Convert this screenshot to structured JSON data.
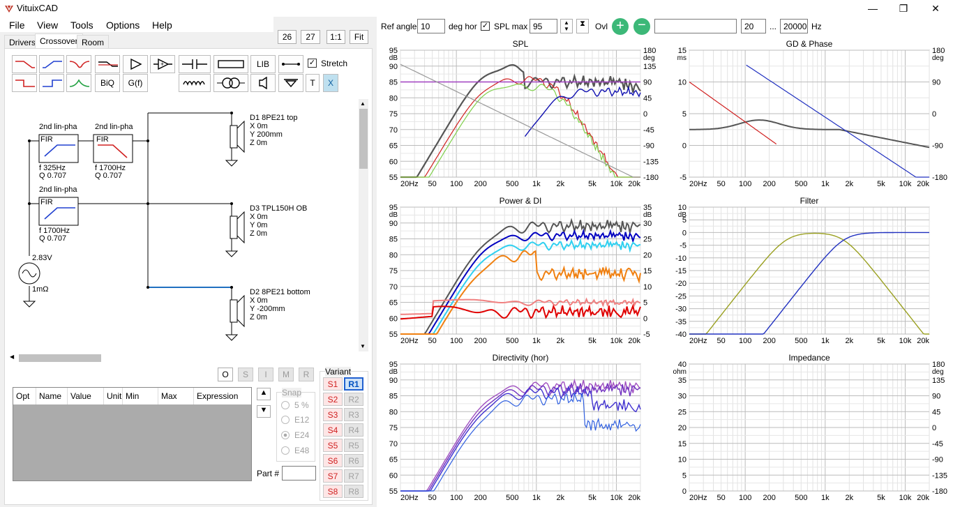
{
  "app": {
    "title": "VituixCAD"
  },
  "window": {
    "minimize": "—",
    "restore": "❐",
    "close": "✕"
  },
  "menu": [
    "File",
    "View",
    "Tools",
    "Options",
    "Help"
  ],
  "zoom": {
    "v1": "26",
    "v2": "27",
    "btn1": "1:1",
    "btn2": "Fit"
  },
  "tabs": [
    "Drivers",
    "Crossover",
    "Room"
  ],
  "toolbar": {
    "lib": "LIB",
    "biq": "BiQ",
    "gf": "G(f)",
    "t": "T",
    "x": "X",
    "stretch": "Stretch"
  },
  "schematic": {
    "blocks": [
      {
        "title": "2nd lin-pha",
        "type": "FIR",
        "f": "f   325Hz",
        "q": "Q  0.707"
      },
      {
        "title": "2nd lin-pha",
        "type": "FIR",
        "f": "f   1700Hz",
        "q": "Q  0.707"
      },
      {
        "title": "2nd lin-pha",
        "type": "FIR",
        "f": "f   1700Hz",
        "q": "Q  0.707"
      }
    ],
    "drivers": [
      {
        "name": "D1 8PE21 top",
        "x": "X 0m",
        "y": "Y 200mm",
        "z": "Z 0m"
      },
      {
        "name": "D3 TPL150H OB",
        "x": "X 0m",
        "y": "Y 0m",
        "z": "Z 0m"
      },
      {
        "name": "D2 8PE21 bottom",
        "x": "X 0m",
        "y": "Y -200mm",
        "z": "Z 0m"
      }
    ],
    "source_voltage": "2.83V",
    "source_r": "1mΩ"
  },
  "optbuttons": [
    "O",
    "S",
    "I",
    "M",
    "R"
  ],
  "table_headers": [
    "Opt",
    "Name",
    "Value",
    "Unit",
    "Min",
    "Max",
    "Expression"
  ],
  "snap": {
    "label": "Snap",
    "options": [
      "5 %",
      "E12",
      "E24",
      "E48"
    ],
    "selected": "E24"
  },
  "part": {
    "label": "Part #",
    "value": ""
  },
  "variant": {
    "label": "Variant",
    "s": [
      "S1",
      "S2",
      "S3",
      "S4",
      "S5",
      "S6",
      "S7",
      "S8"
    ],
    "r": [
      "R1",
      "R2",
      "R3",
      "R4",
      "R5",
      "R6",
      "R7",
      "R8"
    ]
  },
  "controls": {
    "ref_angle_label": "Ref angle",
    "ref_angle": "10",
    "deg_hor": "deg hor",
    "spl_max_label": "SPL max",
    "spl_max": "95",
    "ovl": "Ovl",
    "freq_from": "20",
    "dots": "...",
    "freq_to": "20000",
    "hz": "Hz"
  },
  "charts": {
    "xticks": [
      "20Hz",
      "50",
      "100",
      "200",
      "500",
      "1k",
      "2k",
      "5k",
      "10k",
      "20k"
    ],
    "spl": {
      "title": "SPL",
      "yl": [
        "95",
        "90",
        "85",
        "80",
        "75",
        "70",
        "65",
        "60",
        "55"
      ],
      "yr": [
        "180",
        "135",
        "90",
        "45",
        "0",
        "-45",
        "-90",
        "-135",
        "-180"
      ],
      "ul": "dB",
      "ur": "deg"
    },
    "gd": {
      "title": "GD & Phase",
      "yl": [
        "15",
        "10",
        "5",
        "0",
        "-5"
      ],
      "yr": [
        "180",
        "90",
        "0",
        "-90",
        "-180"
      ],
      "ul": "ms",
      "ur": "deg"
    },
    "power": {
      "title": "Power & DI",
      "yl": [
        "95",
        "90",
        "85",
        "80",
        "75",
        "70",
        "65",
        "60",
        "55"
      ],
      "yr": [
        "35",
        "30",
        "25",
        "20",
        "15",
        "10",
        "5",
        "0",
        "-5"
      ],
      "ul": "dB",
      "ur": "dB"
    },
    "filter": {
      "title": "Filter",
      "yl": [
        "10",
        "5",
        "0",
        "-5",
        "-10",
        "-15",
        "-20",
        "-25",
        "-30",
        "-35",
        "-40"
      ],
      "ul": "dB"
    },
    "dir": {
      "title": "Directivity (hor)",
      "yl": [
        "95",
        "90",
        "85",
        "80",
        "75",
        "70",
        "65",
        "60",
        "55"
      ],
      "ul": "dB"
    },
    "imp": {
      "title": "Impedance",
      "yl": [
        "40",
        "35",
        "30",
        "25",
        "20",
        "15",
        "10",
        "5",
        "0"
      ],
      "yr": [
        "180",
        "135",
        "90",
        "45",
        "0",
        "-45",
        "-90",
        "-135",
        "-180"
      ],
      "ul": "ohm",
      "ur": "deg"
    }
  }
}
